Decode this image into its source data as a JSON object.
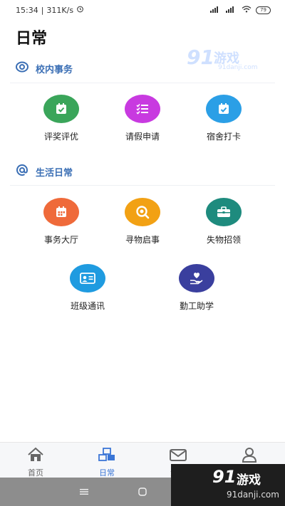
{
  "status_bar": {
    "time": "15:34",
    "net_speed": "311K/s",
    "battery": "79"
  },
  "page": {
    "title": "日常"
  },
  "sections": [
    {
      "title": "校内事务",
      "icon": "eye-target-icon",
      "items": [
        {
          "label": "评奖评优",
          "icon": "calendar-check-icon",
          "color": "#3aa55a"
        },
        {
          "label": "请假申请",
          "icon": "checklist-icon",
          "color": "#c83ae0"
        },
        {
          "label": "宿舍打卡",
          "icon": "calendar-check-icon",
          "color": "#2b9fe6"
        }
      ]
    },
    {
      "title": "生活日常",
      "icon": "at-icon",
      "items": [
        {
          "label": "事务大厅",
          "icon": "calendar-grid-icon",
          "color": "#ef6a3a"
        },
        {
          "label": "寻物启事",
          "icon": "magnifier-icon",
          "color": "#f2a114"
        },
        {
          "label": "失物招领",
          "icon": "briefcase-icon",
          "color": "#1e8b7e"
        },
        {
          "label": "班级通讯",
          "icon": "contact-card-icon",
          "color": "#1f9be0"
        },
        {
          "label": "勤工助学",
          "icon": "heart-hand-icon",
          "color": "#3a3f9e"
        }
      ]
    }
  ],
  "tabbar": [
    {
      "label": "首页",
      "icon": "home-icon",
      "active": false
    },
    {
      "label": "日常",
      "icon": "boxes-icon",
      "active": true
    },
    {
      "label": "消息",
      "icon": "mail-icon",
      "active": false
    },
    {
      "label": "我的",
      "icon": "user-icon",
      "active": false
    }
  ],
  "watermark": {
    "number": "91",
    "text": "游戏",
    "url": "91danji.com"
  },
  "colors": {
    "accent": "#3b76d6",
    "section_title": "#3b6fb5"
  }
}
